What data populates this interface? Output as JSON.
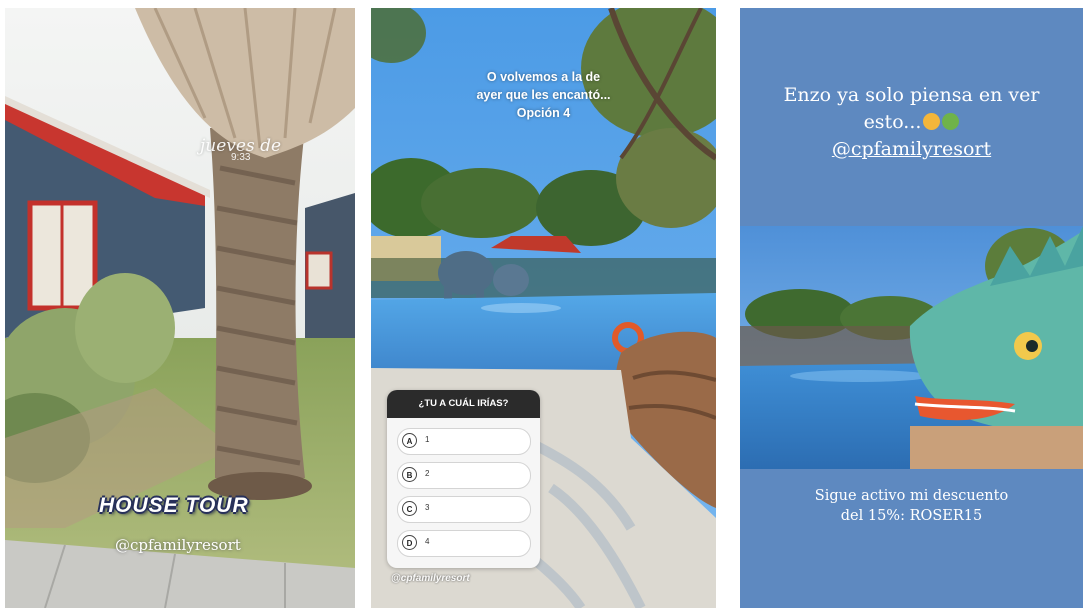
{
  "story_1": {
    "sticker_date": "jueves de",
    "sticker_time": "9:33",
    "title": "HOUSE TOUR",
    "handle": "@cpfamilyresort"
  },
  "story_2": {
    "caption_lines": [
      "O volvemos a la de",
      "ayer que les encantó...",
      "Opción 4"
    ],
    "quiz": {
      "question": "¿TU A CUÁL IRÍAS?",
      "options": [
        {
          "letter": "A",
          "label": "1"
        },
        {
          "letter": "B",
          "label": "2"
        },
        {
          "letter": "C",
          "label": "3"
        },
        {
          "letter": "D",
          "label": "4"
        }
      ]
    },
    "handle": "@cpfamilyresort"
  },
  "story_3": {
    "top_line_1": "Enzo ya solo piensa en ver",
    "top_line_2": "esto...",
    "emojis": [
      "hug-emoji",
      "dragon-emoji"
    ],
    "handle": "@cpfamilyresort",
    "bottom_line_1": "Sigue activo mi descuento",
    "bottom_line_2": "del 15%: ROSER15",
    "background_color": "#5e89c0"
  }
}
